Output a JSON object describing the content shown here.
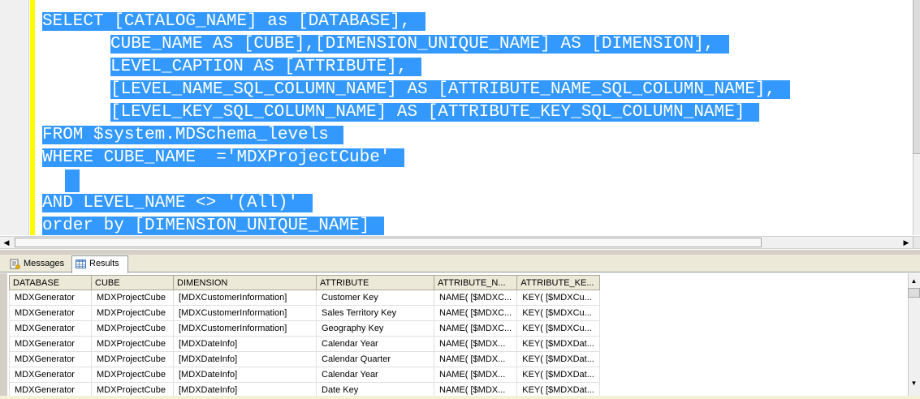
{
  "editor": {
    "lines": [
      "SELECT [CATALOG_NAME] as [DATABASE],",
      "CUBE_NAME AS [CUBE],[DIMENSION_UNIQUE_NAME] AS [DIMENSION],",
      "LEVEL_CAPTION AS [ATTRIBUTE],",
      "[LEVEL_NAME_SQL_COLUMN_NAME] AS [ATTRIBUTE_NAME_SQL_COLUMN_NAME],",
      "[LEVEL_KEY_SQL_COLUMN_NAME] AS [ATTRIBUTE_KEY_SQL_COLUMN_NAME]",
      "FROM $system.MDSchema_levels",
      "WHERE CUBE_NAME  ='MDXProjectCube'",
      "",
      "AND LEVEL_NAME <> '(All)'",
      "order by [DIMENSION_UNIQUE_NAME]"
    ],
    "highlight_color": "#3399ff",
    "change_bar_color": "#ffff00"
  },
  "tabs": {
    "messages": "Messages",
    "results": "Results"
  },
  "grid": {
    "columns": [
      "DATABASE",
      "CUBE",
      "DIMENSION",
      "ATTRIBUTE",
      "ATTRIBUTE_N...",
      "ATTRIBUTE_KE..."
    ],
    "rows": [
      [
        "MDXGenerator",
        "MDXProjectCube",
        "[MDXCustomerInformation]",
        "Customer Key",
        "NAME( [$MDXC...",
        "KEY( [$MDXCu..."
      ],
      [
        "MDXGenerator",
        "MDXProjectCube",
        "[MDXCustomerInformation]",
        "Sales Territory Key",
        "NAME( [$MDXC...",
        "KEY( [$MDXCu..."
      ],
      [
        "MDXGenerator",
        "MDXProjectCube",
        "[MDXCustomerInformation]",
        "Geography Key",
        "NAME( [$MDXC...",
        "KEY( [$MDXCu..."
      ],
      [
        "MDXGenerator",
        "MDXProjectCube",
        "[MDXDateInfo]",
        "Calendar Year",
        "NAME( [$MDX...",
        "KEY( [$MDXDat..."
      ],
      [
        "MDXGenerator",
        "MDXProjectCube",
        "[MDXDateInfo]",
        "Calendar Quarter",
        "NAME( [$MDX...",
        "KEY( [$MDXDat..."
      ],
      [
        "MDXGenerator",
        "MDXProjectCube",
        "[MDXDateInfo]",
        "Calendar Year",
        "NAME( [$MDX...",
        "KEY( [$MDXDat..."
      ],
      [
        "MDXGenerator",
        "MDXProjectCube",
        "[MDXDateInfo]",
        "Date Key",
        "NAME( [$MDX...",
        "KEY( [$MDXDat..."
      ]
    ]
  }
}
